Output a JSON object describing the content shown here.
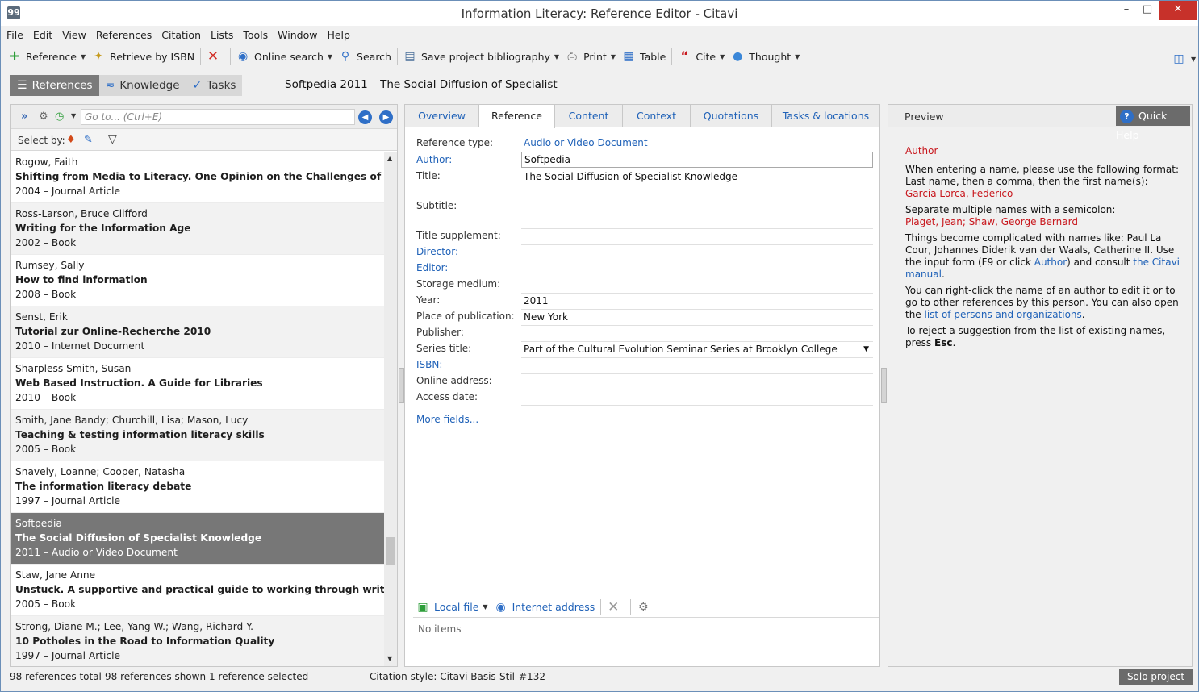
{
  "window": {
    "title": "Information Literacy: Reference Editor - Citavi",
    "app_icon_glyph": "99"
  },
  "menu": [
    "File",
    "Edit",
    "View",
    "References",
    "Citation",
    "Lists",
    "Tools",
    "Window",
    "Help"
  ],
  "toolbar": {
    "reference": "Reference",
    "retrieve_isbn": "Retrieve by ISBN",
    "online_search": "Online search",
    "search": "Search",
    "save_bibliography": "Save project bibliography",
    "print": "Print",
    "table": "Table",
    "cite": "Cite",
    "thought": "Thought"
  },
  "nav_tabs": {
    "references": "References",
    "knowledge": "Knowledge",
    "tasks": "Tasks"
  },
  "reference_heading": "Softpedia 2011 – The Social Diffusion of Specialist",
  "left_panel": {
    "goto_placeholder": "Go to... (Ctrl+E)",
    "select_by": "Select by:",
    "items": [
      {
        "author": "Rogow, Faith",
        "title": "Shifting from Media to Literacy. One Opinion on the Challenges of Media Literacy",
        "meta": "2004 – Journal Article"
      },
      {
        "author": "Ross-Larson, Bruce Clifford",
        "title": "Writing for the Information Age",
        "meta": "2002 – Book"
      },
      {
        "author": "Rumsey, Sally",
        "title": "How to find information",
        "meta": "2008 – Book"
      },
      {
        "author": "Senst, Erik",
        "title": "Tutorial zur Online-Recherche 2010",
        "meta": "2010 – Internet Document"
      },
      {
        "author": "Sharpless Smith, Susan",
        "title": "Web Based Instruction. A Guide for Libraries",
        "meta": "2010 – Book"
      },
      {
        "author": "Smith, Jane Bandy; Churchill, Lisa; Mason, Lucy",
        "title": "Teaching & testing information literacy skills",
        "meta": "2005 – Book"
      },
      {
        "author": "Snavely, Loanne; Cooper, Natasha",
        "title": "The information literacy debate",
        "meta": "1997 – Journal Article"
      },
      {
        "author": "Softpedia",
        "title": "The Social Diffusion of Specialist Knowledge",
        "meta": "2011 – Audio or Video Document"
      },
      {
        "author": "Staw, Jane Anne",
        "title": "Unstuck. A supportive and practical guide to working through writer's block",
        "meta": "2005 – Book"
      },
      {
        "author": "Strong, Diane M.; Lee, Yang W.; Wang, Richard Y.",
        "title": "10 Potholes in the Road to Information Quality",
        "meta": "1997 – Journal Article"
      }
    ]
  },
  "editor": {
    "tabs": [
      "Overview",
      "Reference",
      "Content",
      "Context",
      "Quotations",
      "Tasks & locations"
    ],
    "labels": {
      "reference_type": "Reference type:",
      "author": "Author:",
      "title": "Title:",
      "subtitle": "Subtitle:",
      "title_supplement": "Title supplement:",
      "director": "Director:",
      "editor": "Editor:",
      "storage_medium": "Storage medium:",
      "year": "Year:",
      "place": "Place of publication:",
      "publisher": "Publisher:",
      "series_title": "Series title:",
      "isbn": "ISBN:",
      "online_address": "Online address:",
      "access_date": "Access date:"
    },
    "values": {
      "reference_type": "Audio or Video Document",
      "author": "Softpedia",
      "title": "The Social Diffusion of Specialist Knowledge",
      "year": "2011",
      "place": "New York",
      "series_title": "Part of the Cultural Evolution Seminar Series at Brooklyn College"
    },
    "more_fields": "More fields...",
    "local_file": "Local file",
    "internet_address": "Internet address",
    "no_items": "No items"
  },
  "preview": {
    "label": "Preview",
    "quick_help": "Quick Help",
    "help_title": "Author",
    "p1": "When entering a name, please use the following format:",
    "p1b": "Last name, then a comma, then the first name(s):",
    "ex1": "Garcia Lorca, Federico",
    "p2": "Separate multiple names with a semicolon:",
    "ex2": "Piaget, Jean; Shaw, George Bernard",
    "p3a": "Things become complicated with names like: Paul La Cour, Johannes Diderik van der Waals, Catherine II. Use the input form (F9 or click ",
    "p3link1": "Author",
    "p3b": ") and consult ",
    "p3link2": "the Citavi manual",
    "p3c": ".",
    "p4a": "You can right-click the name of an author to edit it or to go to other references by this person. You can also open the ",
    "p4link": "list of persons and organizations",
    "p4b": ".",
    "p5a": "To reject a suggestion from the list of existing names, press ",
    "p5key": "Esc",
    "p5b": "."
  },
  "status": {
    "total": "98 references total",
    "shown": "98 references shown",
    "selected": "1 reference selected",
    "citation_style": "Citation style: Citavi Basis-Stil",
    "number": "#132",
    "solo": "Solo project"
  },
  "colors": {
    "link_blue": "#2062b8",
    "help_red": "#c8171d",
    "selected_row": "#777777",
    "close_button": "#c7312a"
  }
}
